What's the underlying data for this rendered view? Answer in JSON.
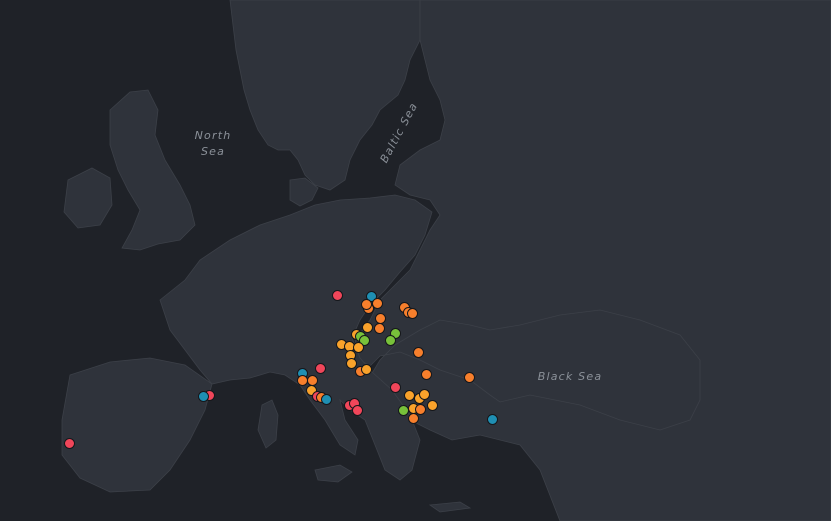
{
  "map": {
    "labels": {
      "north_sea_line1": "North",
      "north_sea_line2": "Sea",
      "baltic_sea": "Baltic Sea",
      "black_sea": "Black Sea"
    },
    "colors": {
      "sea": "#1f2228",
      "land": "#2f333b",
      "border": "#3c4048",
      "label": "#8b9199"
    },
    "categories": {
      "red": "#f0465a",
      "orange": "#f77f2c",
      "amber": "#f9a22b",
      "green": "#78c13a",
      "blue": "#1f8fb3"
    }
  }
}
